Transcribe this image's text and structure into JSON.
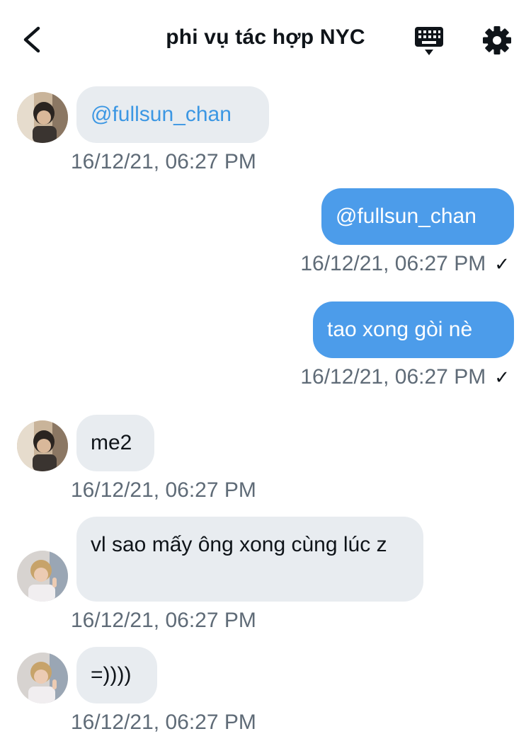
{
  "header": {
    "title": "phi vụ tác hợp NYC",
    "back_icon": "chevron-left-icon",
    "keyboard_icon": "keyboard-icon",
    "settings_icon": "gear-icon"
  },
  "colors": {
    "outgoing_bubble": "#4c9cea",
    "incoming_bubble": "#e8ecf0",
    "mention_text": "#3c97e3",
    "timestamp": "#5f6b77"
  },
  "messages": [
    {
      "direction": "in",
      "text": "@fullsun_chan",
      "time": "16/12/21, 06:27 PM"
    },
    {
      "direction": "out",
      "text": "@fullsun_chan",
      "time": "16/12/21, 06:27 PM",
      "read_mark": "✓"
    },
    {
      "direction": "out",
      "text": "tao xong gòi nè",
      "time": "16/12/21, 06:27 PM",
      "read_mark": "✓"
    },
    {
      "direction": "in",
      "text": "me2",
      "time": "16/12/21, 06:27 PM"
    },
    {
      "direction": "in",
      "text": "vl sao mấy ông xong cùng lúc z",
      "time": "16/12/21, 06:27 PM"
    },
    {
      "direction": "in",
      "text": "=))))",
      "time": "16/12/21, 06:27 PM"
    }
  ]
}
